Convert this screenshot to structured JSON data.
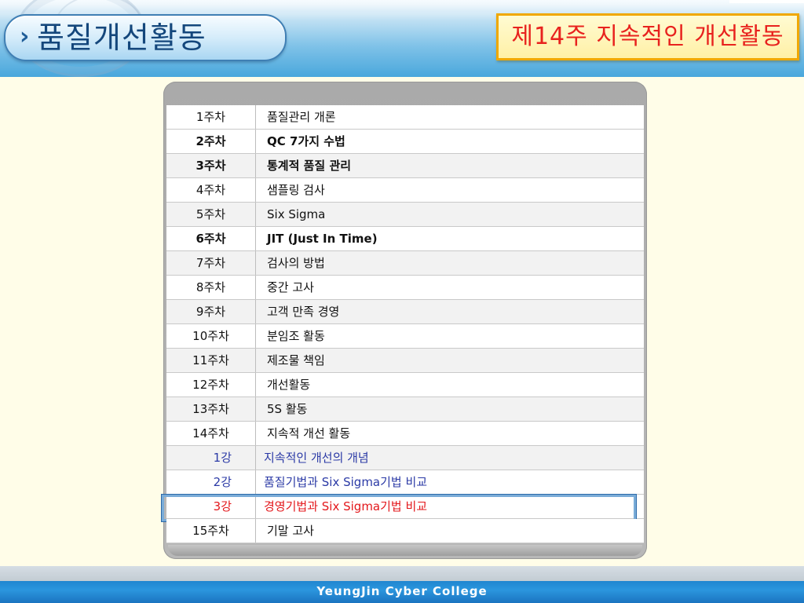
{
  "header": {
    "title": "품질개선활동",
    "week_heading": "제14주  지속적인  개선활동",
    "chevron_icon": "chevron-right-icon",
    "seal_icon": "college-seal-icon"
  },
  "rows": [
    {
      "week": "1주차",
      "title": "품질관리 개론"
    },
    {
      "week": "2주차",
      "title": "QC 7가지 수법"
    },
    {
      "week": "3주차",
      "title": "통계적 품질 관리"
    },
    {
      "week": "4주차",
      "title": "샘플링 검사"
    },
    {
      "week": "5주차",
      "title": "Six Sigma"
    },
    {
      "week": "6주차",
      "title": "JIT (Just In Time)"
    },
    {
      "week": "7주차",
      "title": "검사의 방법"
    },
    {
      "week": "8주차",
      "title": "중간 고사"
    },
    {
      "week": "9주차",
      "title": "고객 만족 경영"
    },
    {
      "week": "10주차",
      "title": "분임조 활동"
    },
    {
      "week": "11주차",
      "title": "제조물 책임"
    },
    {
      "week": "12주차",
      "title": "개선활동"
    },
    {
      "week": "13주차",
      "title": "5S 활동"
    },
    {
      "week": "14주차",
      "title": "지속적 개선 활동"
    },
    {
      "week": "1강",
      "title": "지속적인 개선의 개념"
    },
    {
      "week": "2강",
      "title": "품질기법과 Six Sigma기법 비교"
    },
    {
      "week": "3강",
      "title": "경영기법과 Six Sigma기법 비교"
    },
    {
      "week": "15주차",
      "title": "기말 고사"
    }
  ],
  "footer": {
    "college": "YeungJin Cyber College"
  },
  "colors": {
    "current_lecture": "#e3171b",
    "lecture_link": "#2b3aa6",
    "week_heading": "#e8221e"
  }
}
